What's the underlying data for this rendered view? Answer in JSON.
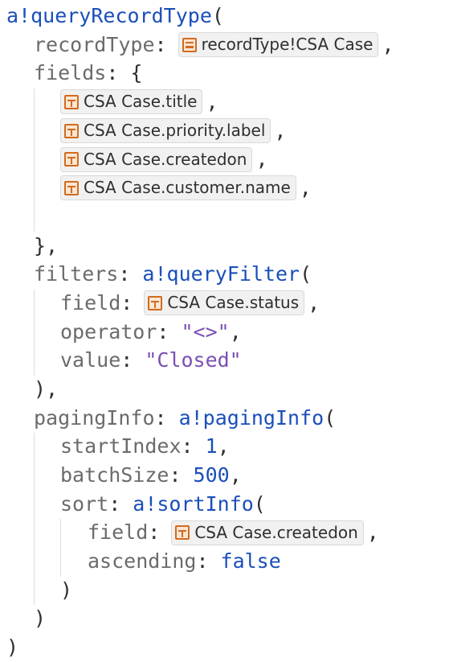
{
  "code": {
    "fn_query": "a!queryRecordType",
    "open_paren": "(",
    "close_paren": ")",
    "close_paren_comma": "),",
    "comma": ",",
    "brace_open": "{",
    "brace_close_comma": "},",
    "colon": ":",
    "recordType_key": "recordType",
    "recordType_chip": "recordType!CSA Case",
    "fields_key": "fields",
    "fields": [
      "CSA Case.title",
      "CSA Case.priority.label",
      "CSA Case.createdon",
      "CSA Case.customer.name"
    ],
    "filters_key": "filters",
    "fn_filter": "a!queryFilter",
    "field_key": "field",
    "filter_field_chip": "CSA Case.status",
    "operator_key": "operator",
    "operator_value": "\"<>\"",
    "value_key": "value",
    "value_value": "\"Closed\"",
    "pagingInfo_key": "pagingInfo",
    "fn_paging": "a!pagingInfo",
    "startIndex_key": "startIndex",
    "startIndex_value": "1",
    "batchSize_key": "batchSize",
    "batchSize_value": "500",
    "sort_key": "sort",
    "fn_sort": "a!sortInfo",
    "sort_field_chip": "CSA Case.createdon",
    "ascending_key": "ascending",
    "ascending_value": "false"
  },
  "colors": {
    "function": "#1a4fba",
    "key": "#6b6b6b",
    "string": "#7a4fb5",
    "chip_icon": "#d26b1f"
  },
  "icons": {
    "record_type": "record-type-icon",
    "record_field": "record-field-icon"
  }
}
